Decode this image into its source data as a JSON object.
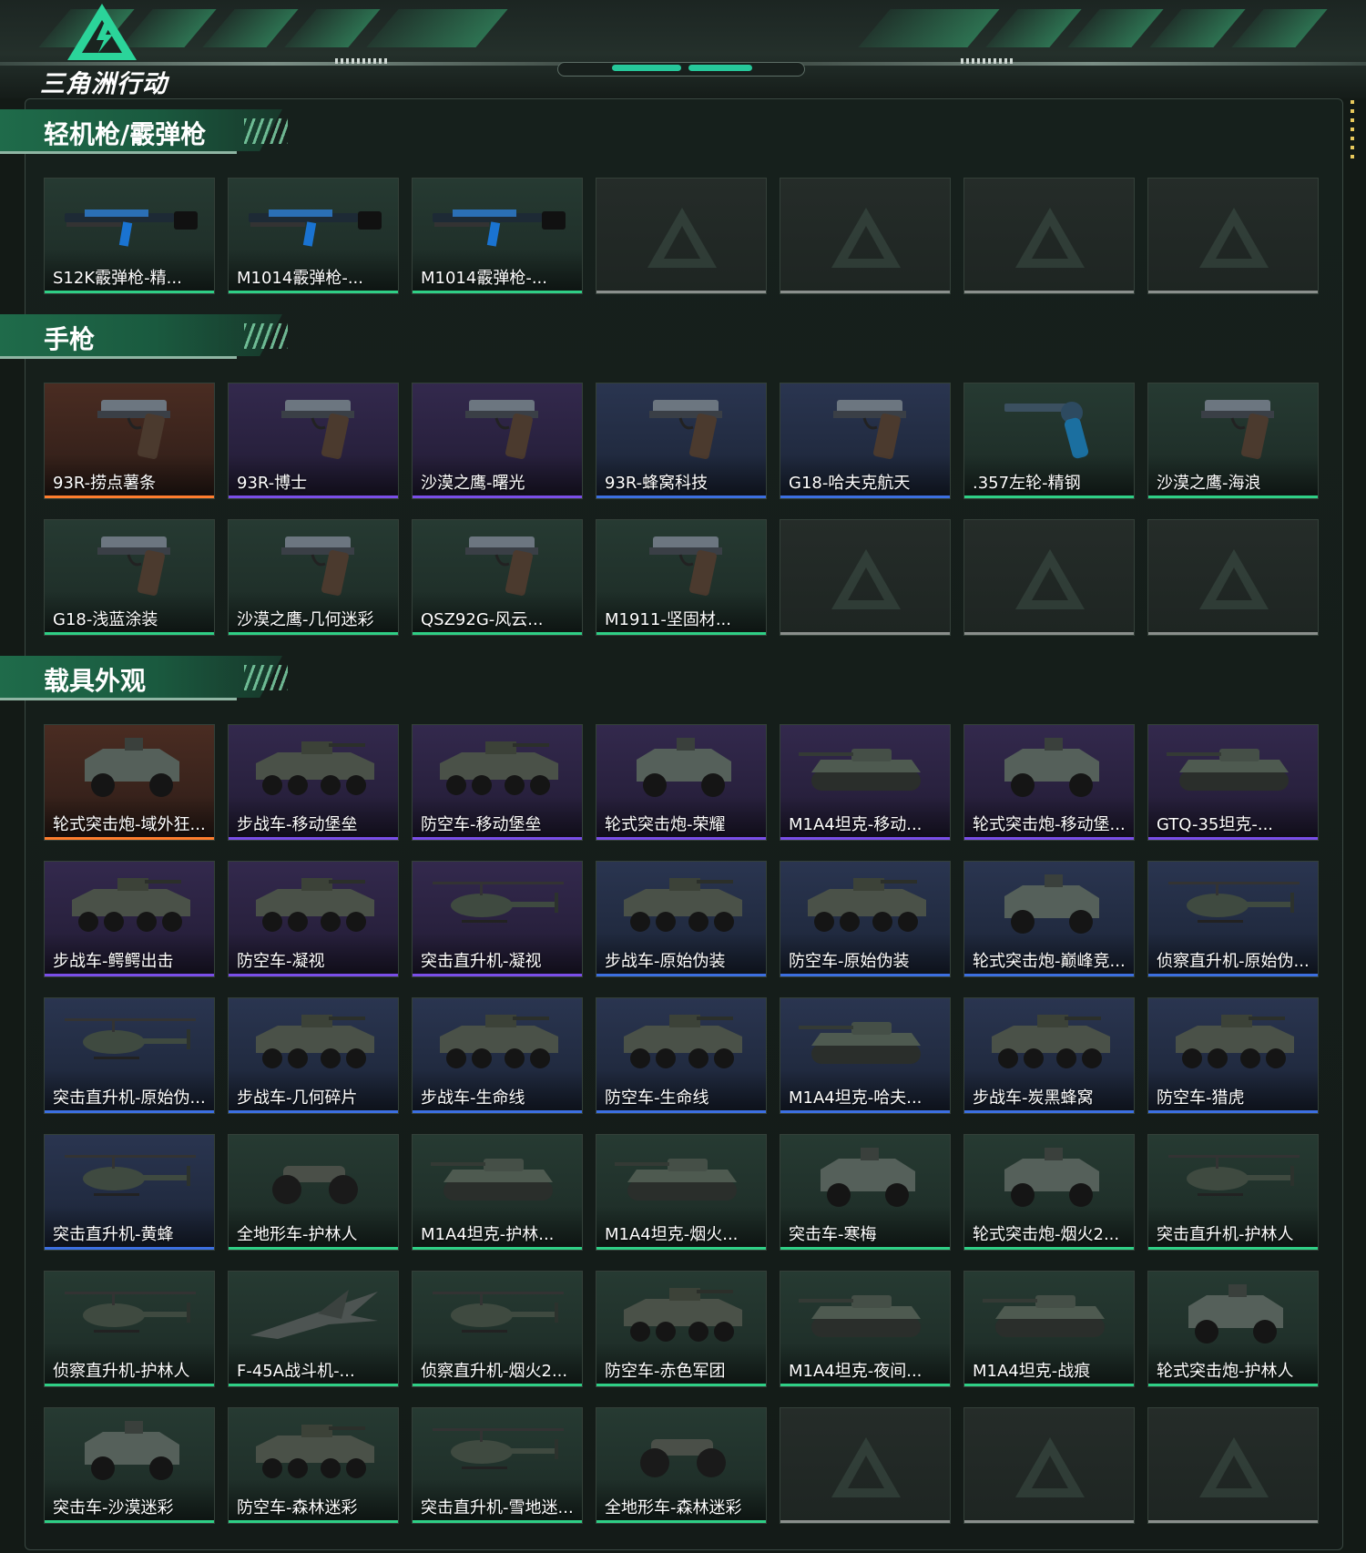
{
  "app": {
    "logo_text": "三角洲行动"
  },
  "colors": {
    "accent": "#2fcf86",
    "rare_blue": "#3c6fe0",
    "epic_purple": "#7a4ee8",
    "legend_orange": "#ff7d2e",
    "empty_gray": "#8a8f8c"
  },
  "sections": [
    {
      "title": "轻机枪/霰弹枪",
      "items": [
        {
          "name": "S12K霰弹枪-精...",
          "quality": "green",
          "icon": "shotgun"
        },
        {
          "name": "M1014霰弹枪-...",
          "quality": "green",
          "icon": "shotgun"
        },
        {
          "name": "M1014霰弹枪-...",
          "quality": "green",
          "icon": "shotgun"
        },
        {
          "name": "",
          "quality": "empty",
          "icon": "placeholder"
        },
        {
          "name": "",
          "quality": "empty",
          "icon": "placeholder"
        },
        {
          "name": "",
          "quality": "empty",
          "icon": "placeholder"
        },
        {
          "name": "",
          "quality": "empty",
          "icon": "placeholder"
        }
      ]
    },
    {
      "title": "手枪",
      "items": [
        {
          "name": "93R-捞点薯条",
          "quality": "orange",
          "icon": "pistol"
        },
        {
          "name": "93R-博士",
          "quality": "purple",
          "icon": "pistol"
        },
        {
          "name": "沙漠之鹰-曙光",
          "quality": "purple",
          "icon": "pistol"
        },
        {
          "name": "93R-蜂窝科技",
          "quality": "blue",
          "icon": "pistol"
        },
        {
          "name": "G18-哈夫克航天",
          "quality": "blue",
          "icon": "pistol"
        },
        {
          "name": ".357左轮-精钢",
          "quality": "green",
          "icon": "revolver"
        },
        {
          "name": "沙漠之鹰-海浪",
          "quality": "green",
          "icon": "pistol"
        },
        {
          "name": "G18-浅蓝涂装",
          "quality": "green",
          "icon": "pistol"
        },
        {
          "name": "沙漠之鹰-几何迷彩",
          "quality": "green",
          "icon": "pistol"
        },
        {
          "name": "QSZ92G-风云...",
          "quality": "green",
          "icon": "pistol"
        },
        {
          "name": "M1911-坚固材...",
          "quality": "green",
          "icon": "pistol"
        },
        {
          "name": "",
          "quality": "empty",
          "icon": "placeholder"
        },
        {
          "name": "",
          "quality": "empty",
          "icon": "placeholder"
        },
        {
          "name": "",
          "quality": "empty",
          "icon": "placeholder"
        }
      ]
    },
    {
      "title": "载具外观",
      "items": [
        {
          "name": "轮式突击炮-域外狂...",
          "quality": "orange",
          "icon": "wheeled-vehicle"
        },
        {
          "name": "步战车-移动堡垒",
          "quality": "purple",
          "icon": "ifv"
        },
        {
          "name": "防空车-移动堡垒",
          "quality": "purple",
          "icon": "ifv"
        },
        {
          "name": "轮式突击炮-荣耀",
          "quality": "purple",
          "icon": "wheeled-vehicle"
        },
        {
          "name": "M1A4坦克-移动...",
          "quality": "purple",
          "icon": "tank"
        },
        {
          "name": "轮式突击炮-移动堡...",
          "quality": "purple",
          "icon": "wheeled-vehicle"
        },
        {
          "name": "GTQ-35坦克-...",
          "quality": "purple",
          "icon": "tank"
        },
        {
          "name": "步战车-鳄鳄出击",
          "quality": "purple",
          "icon": "ifv"
        },
        {
          "name": "防空车-凝视",
          "quality": "purple",
          "icon": "ifv"
        },
        {
          "name": "突击直升机-凝视",
          "quality": "purple",
          "icon": "helicopter"
        },
        {
          "name": "步战车-原始伪装",
          "quality": "blue",
          "icon": "ifv"
        },
        {
          "name": "防空车-原始伪装",
          "quality": "blue",
          "icon": "ifv"
        },
        {
          "name": "轮式突击炮-巅峰竞...",
          "quality": "blue",
          "icon": "wheeled-vehicle"
        },
        {
          "name": "侦察直升机-原始伪...",
          "quality": "blue",
          "icon": "helicopter"
        },
        {
          "name": "突击直升机-原始伪...",
          "quality": "blue",
          "icon": "helicopter"
        },
        {
          "name": "步战车-几何碎片",
          "quality": "blue",
          "icon": "ifv"
        },
        {
          "name": "步战车-生命线",
          "quality": "blue",
          "icon": "ifv"
        },
        {
          "name": "防空车-生命线",
          "quality": "blue",
          "icon": "ifv"
        },
        {
          "name": "M1A4坦克-哈夫...",
          "quality": "blue",
          "icon": "tank"
        },
        {
          "name": "步战车-炭黑蜂窝",
          "quality": "blue",
          "icon": "ifv"
        },
        {
          "name": "防空车-猎虎",
          "quality": "blue",
          "icon": "ifv"
        },
        {
          "name": "突击直升机-黄蜂",
          "quality": "blue",
          "icon": "helicopter"
        },
        {
          "name": "全地形车-护林人",
          "quality": "green",
          "icon": "atv"
        },
        {
          "name": "M1A4坦克-护林...",
          "quality": "green",
          "icon": "tank"
        },
        {
          "name": "M1A4坦克-烟火...",
          "quality": "green",
          "icon": "tank"
        },
        {
          "name": "突击车-寒梅",
          "quality": "green",
          "icon": "wheeled-vehicle"
        },
        {
          "name": "轮式突击炮-烟火2...",
          "quality": "green",
          "icon": "wheeled-vehicle"
        },
        {
          "name": "突击直升机-护林人",
          "quality": "green",
          "icon": "helicopter"
        },
        {
          "name": "侦察直升机-护林人",
          "quality": "green",
          "icon": "helicopter"
        },
        {
          "name": "F-45A战斗机-...",
          "quality": "green",
          "icon": "jet"
        },
        {
          "name": "侦察直升机-烟火2...",
          "quality": "green",
          "icon": "helicopter"
        },
        {
          "name": "防空车-赤色军团",
          "quality": "green",
          "icon": "ifv"
        },
        {
          "name": "M1A4坦克-夜间...",
          "quality": "green",
          "icon": "tank"
        },
        {
          "name": "M1A4坦克-战痕",
          "quality": "green",
          "icon": "tank"
        },
        {
          "name": "轮式突击炮-护林人",
          "quality": "green",
          "icon": "wheeled-vehicle"
        },
        {
          "name": "突击车-沙漠迷彩",
          "quality": "green",
          "icon": "wheeled-vehicle"
        },
        {
          "name": "防空车-森林迷彩",
          "quality": "green",
          "icon": "ifv"
        },
        {
          "name": "突击直升机-雪地迷...",
          "quality": "green",
          "icon": "helicopter"
        },
        {
          "name": "全地形车-森林迷彩",
          "quality": "green",
          "icon": "atv"
        },
        {
          "name": "",
          "quality": "empty",
          "icon": "placeholder"
        },
        {
          "name": "",
          "quality": "empty",
          "icon": "placeholder"
        },
        {
          "name": "",
          "quality": "empty",
          "icon": "placeholder"
        }
      ]
    }
  ]
}
